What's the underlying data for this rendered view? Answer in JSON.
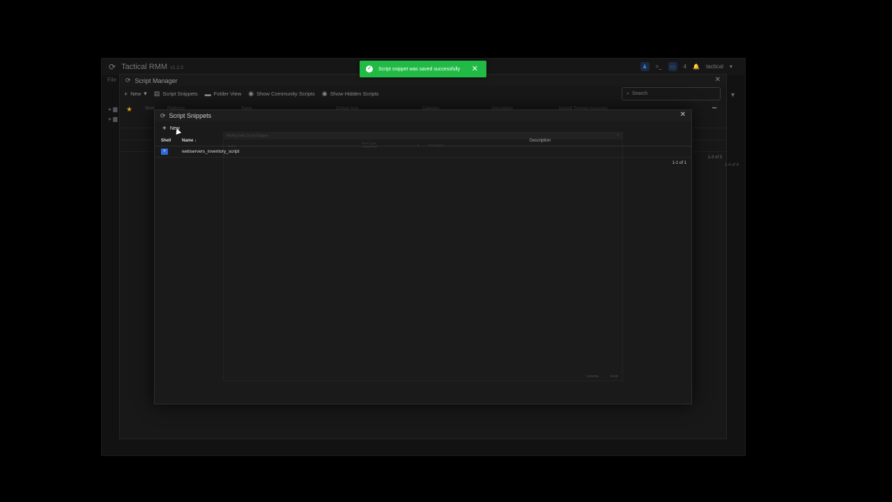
{
  "app": {
    "title": "Tactical RMM",
    "version": "v1.2.0",
    "file_menu": "File",
    "header_right": {
      "terminal": ">_",
      "agent_count": "4",
      "user": "tactical"
    }
  },
  "script_manager": {
    "title": "Script Manager",
    "toolbar": {
      "new_label": "New",
      "snippets_label": "Script Snippets",
      "folder_view_label": "Folder View",
      "community_label": "Show Community Scripts",
      "hidden_label": "Show Hidden Scripts"
    },
    "search_placeholder": "Search",
    "columns": [
      "Shell",
      "Platforms",
      "Name",
      "Default Args",
      "Category",
      "Description",
      "Default Timeout (seconds)"
    ],
    "counter": "1-3 of 3",
    "counter_behind": "1-4 of 4"
  },
  "script_snippets": {
    "title": "Script Snippets",
    "new_label": "New",
    "columns": {
      "shell": "Shell",
      "name": "Name",
      "description": "Description"
    },
    "rows": [
      {
        "shell_icon": "powershell-icon",
        "name": "webservers_inventory_script"
      }
    ],
    "pager": "1-1 of 1",
    "ghost_dialog": {
      "title": "Adding New Script Snippet",
      "fields": [
        "Name",
        "Shell Type",
        "Powershell",
        "Description"
      ],
      "buttons": [
        "CANCEL",
        "SAVE"
      ]
    }
  },
  "toast": {
    "message": "Script snippet was saved successfully"
  },
  "colors": {
    "accent": "#3a7bd5",
    "success": "#21ba45",
    "powershell": "#2f6bd8"
  }
}
